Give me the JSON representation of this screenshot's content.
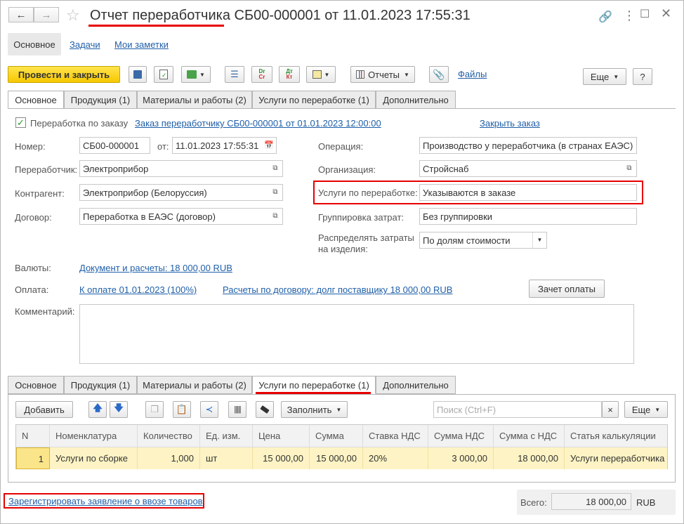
{
  "window": {
    "title": "Отчет переработчика СБ00-000001 от 11.01.2023 17:55:31"
  },
  "nav": {
    "tabs": [
      "Основное",
      "Задачи",
      "Мои заметки"
    ]
  },
  "toolbar": {
    "post_close": "Провести и закрыть",
    "reports": "Отчеты",
    "files": "Файлы",
    "more": "Еще",
    "help": "?",
    "dt_top": "Dr",
    "dt_bottom": "Cr",
    "dk_top": "Дт",
    "dk_bottom": "Кт"
  },
  "top_tabs": [
    "Основное",
    "Продукция (1)",
    "Материалы и работы (2)",
    "Услуги по переработке (1)",
    "Дополнительно"
  ],
  "form": {
    "processing_by_order_label": "Переработка по заказу",
    "order_link": "Заказ переработчику СБ00-000001 от 01.01.2023 12:00:00",
    "close_order_link": "Закрыть заказ",
    "number_label": "Номер:",
    "number_value": "СБ00-000001",
    "from_label": "от:",
    "date_value": "11.01.2023 17:55:31",
    "processor_label": "Переработчик:",
    "processor_value": "Электроприбор",
    "counterparty_label": "Контрагент:",
    "counterparty_value": "Электроприбор (Белоруссия)",
    "contract_label": "Договор:",
    "contract_value": "Переработка в ЕАЭС (договор)",
    "operation_label": "Операция:",
    "operation_value": "Производство у переработчика (в странах ЕАЭС)",
    "organization_label": "Организация:",
    "organization_value": "Стройснаб",
    "services_label": "Услуги по переработке:",
    "services_value": "Указываются в заказе",
    "cost_grouping_label": "Группировка затрат:",
    "cost_grouping_value": "Без группировки",
    "distribute_label_1": "Распределять затраты",
    "distribute_label_2": "на изделия:",
    "distribute_value": "По долям стоимости",
    "currency_label": "Валюты:",
    "currency_link": "Документ и расчеты: 18 000,00 RUB",
    "payment_label": "Оплата:",
    "payment_link": "К оплате 01.01.2023 (100%)",
    "settlements_link": "Расчеты по договору: долг поставщику 18 000,00 RUB",
    "offset_button": "Зачет оплаты",
    "comment_label": "Комментарий:"
  },
  "bottom_tabs": [
    "Основное",
    "Продукция (1)",
    "Материалы и работы (2)",
    "Услуги по переработке (1)",
    "Дополнительно"
  ],
  "table_toolbar": {
    "add": "Добавить",
    "fill": "Заполнить",
    "search_placeholder": "Поиск (Ctrl+F)",
    "clear": "×",
    "more": "Еще"
  },
  "table": {
    "headers": [
      "N",
      "Номенклатура",
      "Количество",
      "Ед. изм.",
      "Цена",
      "Сумма",
      "Ставка НДС",
      "Сумма НДС",
      "Сумма с НДС",
      "Статья калькуляции"
    ],
    "rows": [
      [
        "1",
        "Услуги по сборке",
        "1,000",
        "шт",
        "15 000,00",
        "15 000,00",
        "20%",
        "3 000,00",
        "18 000,00",
        "Услуги переработчика"
      ]
    ]
  },
  "footer": {
    "register_link": "Зарегистрировать заявление о ввозе товаров",
    "total_label": "Всего:",
    "total_value": "18 000,00",
    "currency": "RUB"
  }
}
